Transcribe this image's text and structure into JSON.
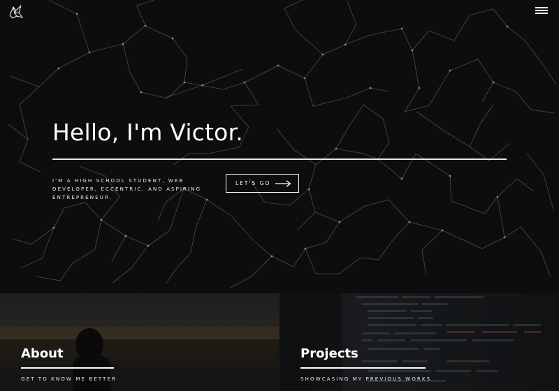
{
  "hero": {
    "title": "Hello, I'm Victor.",
    "tagline": "I'm a high school student, web developer, eccentric, and aspiring entrepreneur.",
    "cta_label": "LET'S GO"
  },
  "nav": {
    "logo_icon": "origami-bird-icon",
    "menu_icon": "hamburger-menu-icon"
  },
  "tiles": [
    {
      "title": "About",
      "subtitle": "GET TO KNOW ME BETTER"
    },
    {
      "title": "Projects",
      "subtitle": "SHOWCASING MY PREVIOUS WORKS"
    }
  ],
  "colors": {
    "background": "#0d0d0e",
    "text": "#ffffff",
    "network_line": "#8a8a8a"
  }
}
